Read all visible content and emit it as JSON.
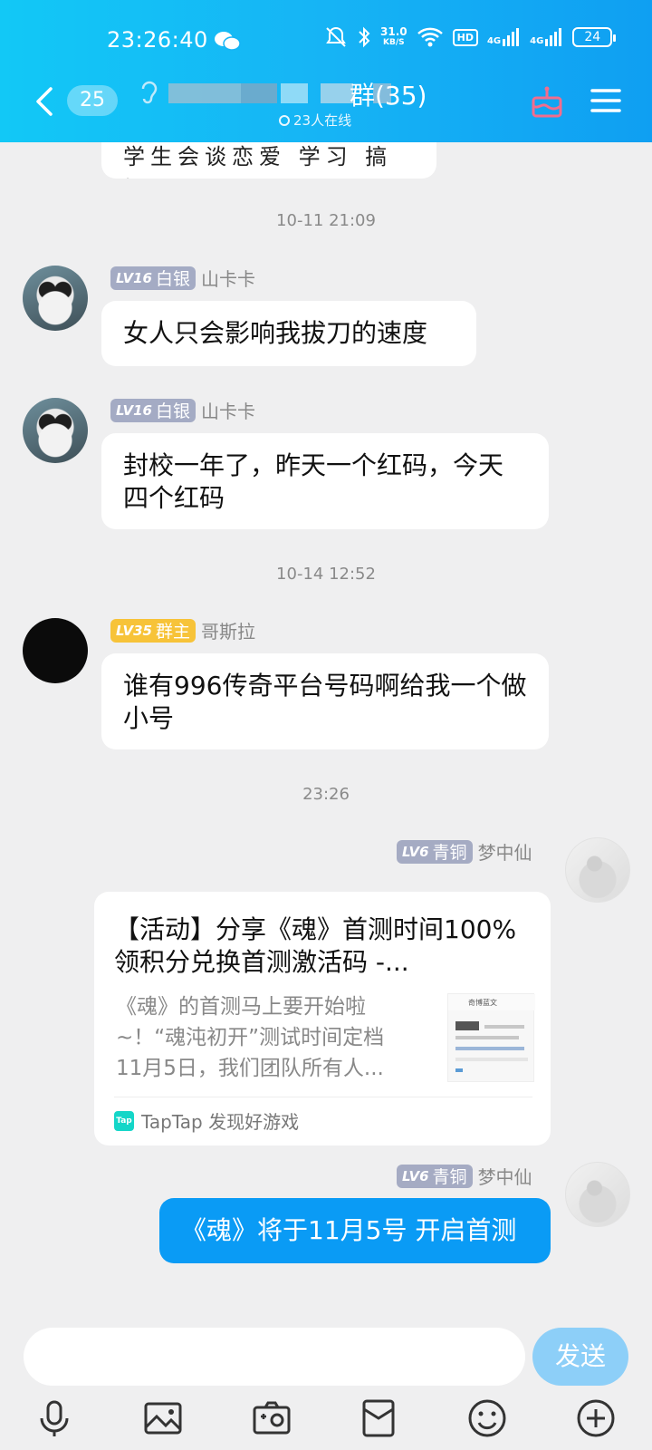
{
  "status_bar": {
    "time": "23:26:40",
    "net_speed": "31.0",
    "net_unit": "KB/S",
    "hd": "HD",
    "signal1": "4G",
    "signal2": "4G",
    "battery": "24"
  },
  "header": {
    "unread_count": "25",
    "title": "群(35)",
    "online": "23人在线"
  },
  "chat": {
    "partial_text": "学生会谈恋爱 学习 搞好",
    "timestamps": [
      "10-11 21:09",
      "10-14 12:52",
      "23:26"
    ],
    "messages": [
      {
        "level": "LV16",
        "rank": "白银",
        "sender": "山卡卡",
        "text": "女人只会影响我拔刀的速度"
      },
      {
        "level": "LV16",
        "rank": "白银",
        "sender": "山卡卡",
        "text": "封校一年了，昨天一个红码，今天四个红码"
      },
      {
        "level": "LV35",
        "rank": "群主",
        "sender": "哥斯拉",
        "text": "谁有996传奇平台号码啊给我一个做小号"
      },
      {
        "level": "LV6",
        "rank": "青铜",
        "sender": "梦中仙"
      },
      {
        "level": "LV6",
        "rank": "青铜",
        "sender": "梦中仙",
        "text": "《魂》将于11月5号 开启首测"
      }
    ],
    "share_card": {
      "title": "【活动】分享《魂》首测时间100%领积分兑换首测激活码 -...",
      "desc": "《魂》的首测马上要开始啦~！“魂沌初开”测试时间定档11月5日，我们团队所有人...",
      "thumb_title": "奇博蓝文",
      "source": "TapTap 发现好游戏",
      "source_icon_text": "Tap"
    }
  },
  "input": {
    "value": "",
    "send_label": "发送"
  },
  "toolbar": {
    "icons": [
      "microphone-icon",
      "image-icon",
      "camera-icon",
      "red-packet-icon",
      "emoji-icon",
      "plus-icon"
    ]
  },
  "colors": {
    "header_accent": "#12b7f5",
    "my_bubble": "#0a9bf5",
    "lv_gold": "#f7c339",
    "lv_silver": "#a4abc4"
  }
}
